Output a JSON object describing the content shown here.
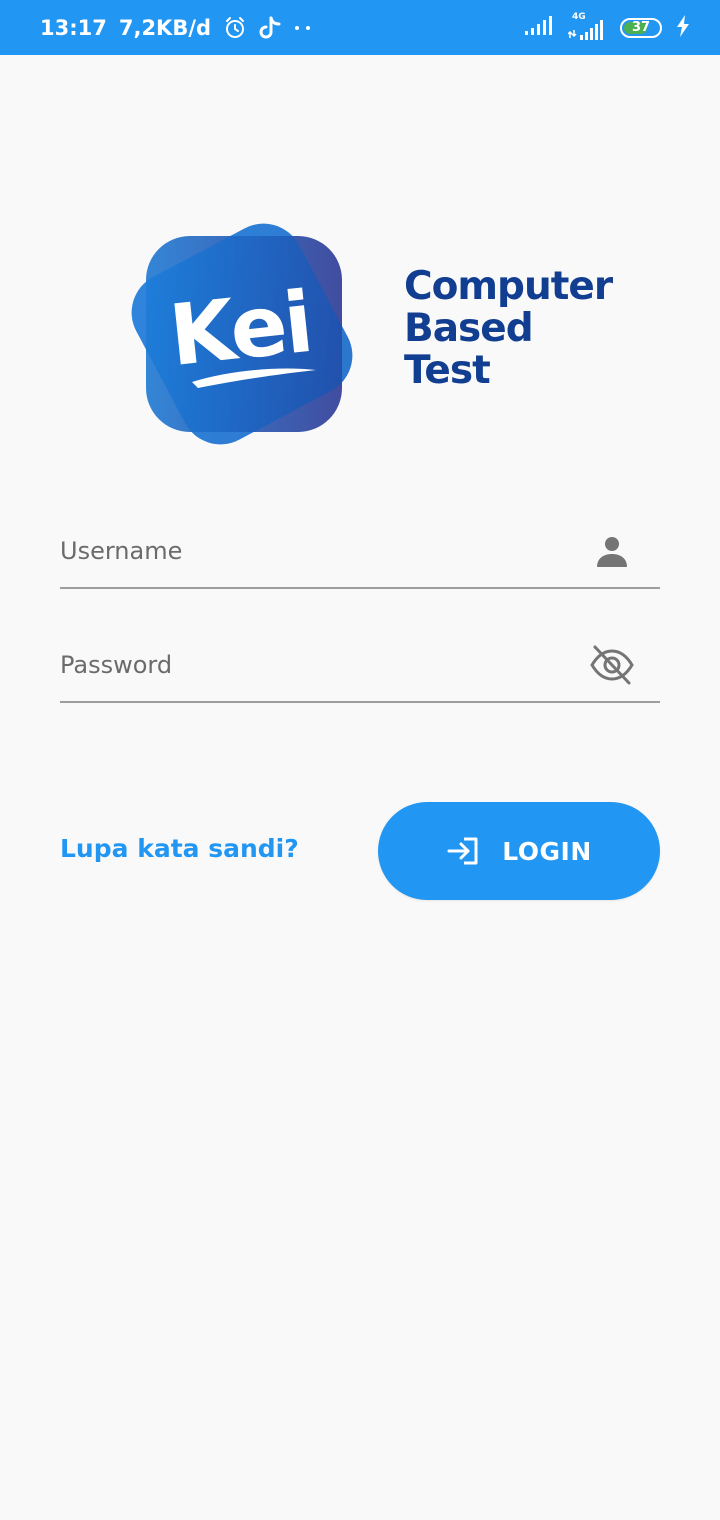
{
  "status_bar": {
    "time": "13:17",
    "network_speed": "7,2KB/d",
    "battery_level": "37",
    "network_type": "4G",
    "icons": [
      "alarm-icon",
      "tiktok-icon",
      "more-dots-icon",
      "signal-icon",
      "signal-4g-icon",
      "battery-icon",
      "charging-icon"
    ],
    "color": "#2196f3"
  },
  "logo": {
    "brand": "Kei",
    "title_lines": [
      "Computer",
      "Based",
      "Test"
    ],
    "title_color": "#123e91"
  },
  "form": {
    "username_placeholder": "Username",
    "username_value": "",
    "username_icon": "person-icon",
    "password_placeholder": "Password",
    "password_value": "",
    "password_icon": "eye-off-icon"
  },
  "actions": {
    "forgot_password": "Lupa kata sandi?",
    "login_label": "LOGIN",
    "login_icon": "login-icon",
    "accent_color": "#2196f3"
  }
}
